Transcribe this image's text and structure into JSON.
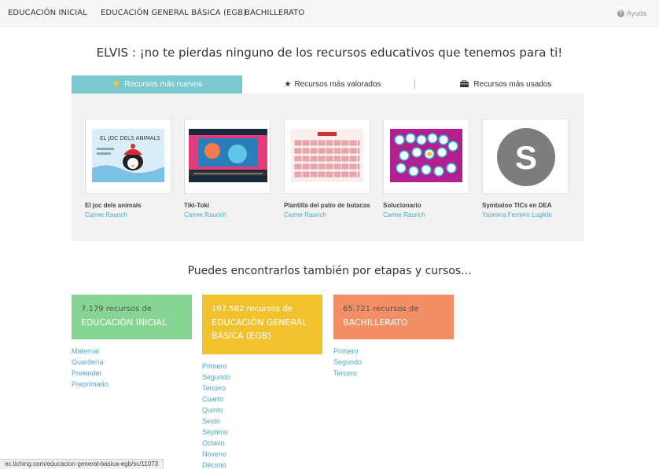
{
  "topnav": {
    "items": [
      "EDUCACIÓN INICIAL",
      "EDUCACIÓN GENERAL BÁSICA (EGB)",
      "BACHILLERATO"
    ],
    "help": "Ayuda"
  },
  "headline": "ELVIS : ¡no te pierdas ninguno de los recursos educativos que tenemos para ti!",
  "tabs": [
    {
      "label": "Recursos más nuevos",
      "icon": "lightning-icon"
    },
    {
      "label": "Recursos más valorados",
      "icon": "star-icon"
    },
    {
      "label": "Recursos más usados",
      "icon": "briefcase-icon"
    }
  ],
  "resources": [
    {
      "title": "El joc dels animals",
      "author": "Carme Raurich",
      "thumb_text": "EL JOC DELS ANIMALS"
    },
    {
      "title": "Tiki-Toki",
      "author": "Carme Raurich"
    },
    {
      "title": "Plantilla del patio de butacas",
      "author": "Carme Raurich"
    },
    {
      "title": "Solucionario",
      "author": "Carme Raurich"
    },
    {
      "title": "Symbaloo TICs en DEA",
      "author": "Yasmina Ferreiro Lugilde",
      "thumb_letter": "S"
    }
  ],
  "sub_headline": "Puedes encontrarlos también por etapas y cursos...",
  "stages": [
    {
      "count": "7.179 recursos de",
      "name": "EDUCACIÓN INICIAL",
      "courses": [
        "Maternal",
        "Guardería",
        "Prekinder",
        "Preprimario"
      ],
      "color": "#87d595"
    },
    {
      "count": "197.582 recursos de",
      "name": "EDUCACIÓN GENERAL BÁSICA (EGB)",
      "courses": [
        "Primero",
        "Segundo",
        "Tercero",
        "Cuarto",
        "Quinto",
        "Sexto",
        "Séptimo",
        "Octavo",
        "Noveno",
        "Décimo"
      ],
      "color": "#f2c22e"
    },
    {
      "count": "65.721 recursos de",
      "name": "BACHILLERATO",
      "courses": [
        "Primero",
        "Segundo",
        "Tercero"
      ],
      "color": "#f28f67"
    }
  ],
  "status_url": "ec.tiching.com/educacion-general-basica-egb/sc/11073"
}
